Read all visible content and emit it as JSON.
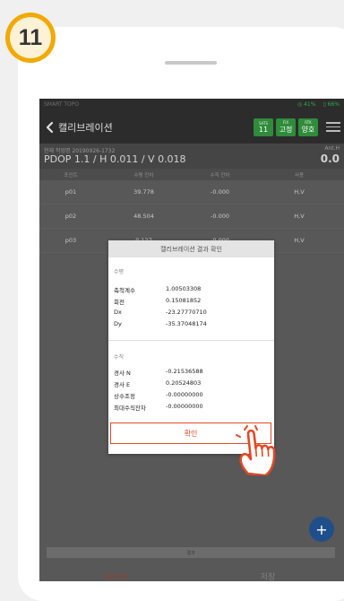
{
  "step": {
    "number": "11",
    "color": "#f2a900"
  },
  "statusbar": {
    "app": "SMART TOPO",
    "satellite": "41%",
    "battery": "66%"
  },
  "appbar": {
    "title": "캘리브레이션",
    "chips": [
      {
        "label": "SATS",
        "value": "11"
      },
      {
        "label": "FIX",
        "value": "고정"
      },
      {
        "label": "RTK",
        "value": "양호"
      }
    ]
  },
  "info": {
    "subtitle": "현재 작업명 20190926-1732",
    "pdop": "PDOP 1.1 / H 0.011 / V 0.018",
    "ant_label": "Ant.H",
    "ant_value": "0.0"
  },
  "table": {
    "headers": [
      "포인트",
      "수평 잔차",
      "수직 잔차",
      "사용"
    ],
    "rows": [
      [
        "p01",
        "39.778",
        "-0.000",
        "H,V"
      ],
      [
        "p02",
        "48.504",
        "-0.000",
        "H,V"
      ],
      [
        "p03",
        "0.127",
        "-0.000",
        "H,V"
      ]
    ]
  },
  "dialog": {
    "title": "캘리브레이션 결과 확인",
    "horizontal_label": "수평",
    "horizontal": [
      {
        "key": "축척계수",
        "value": "1.00503308"
      },
      {
        "key": "회전",
        "value": "0.15081852"
      },
      {
        "key": "Dx",
        "value": "-23.27770710"
      },
      {
        "key": "Dy",
        "value": "-35.37048174"
      }
    ],
    "vertical_label": "수직",
    "vertical": [
      {
        "key": "경사 N",
        "value": "-0.21536588"
      },
      {
        "key": "경사 E",
        "value": "0.20524803"
      },
      {
        "key": "상수조정",
        "value": "-0.00000000"
      },
      {
        "key": "최대수직잔차",
        "value": "-0.00000000"
      }
    ],
    "confirm": "확인"
  },
  "fab": "+",
  "bottom": {
    "bar": "결과",
    "prev": "나가기",
    "save": "저장"
  }
}
